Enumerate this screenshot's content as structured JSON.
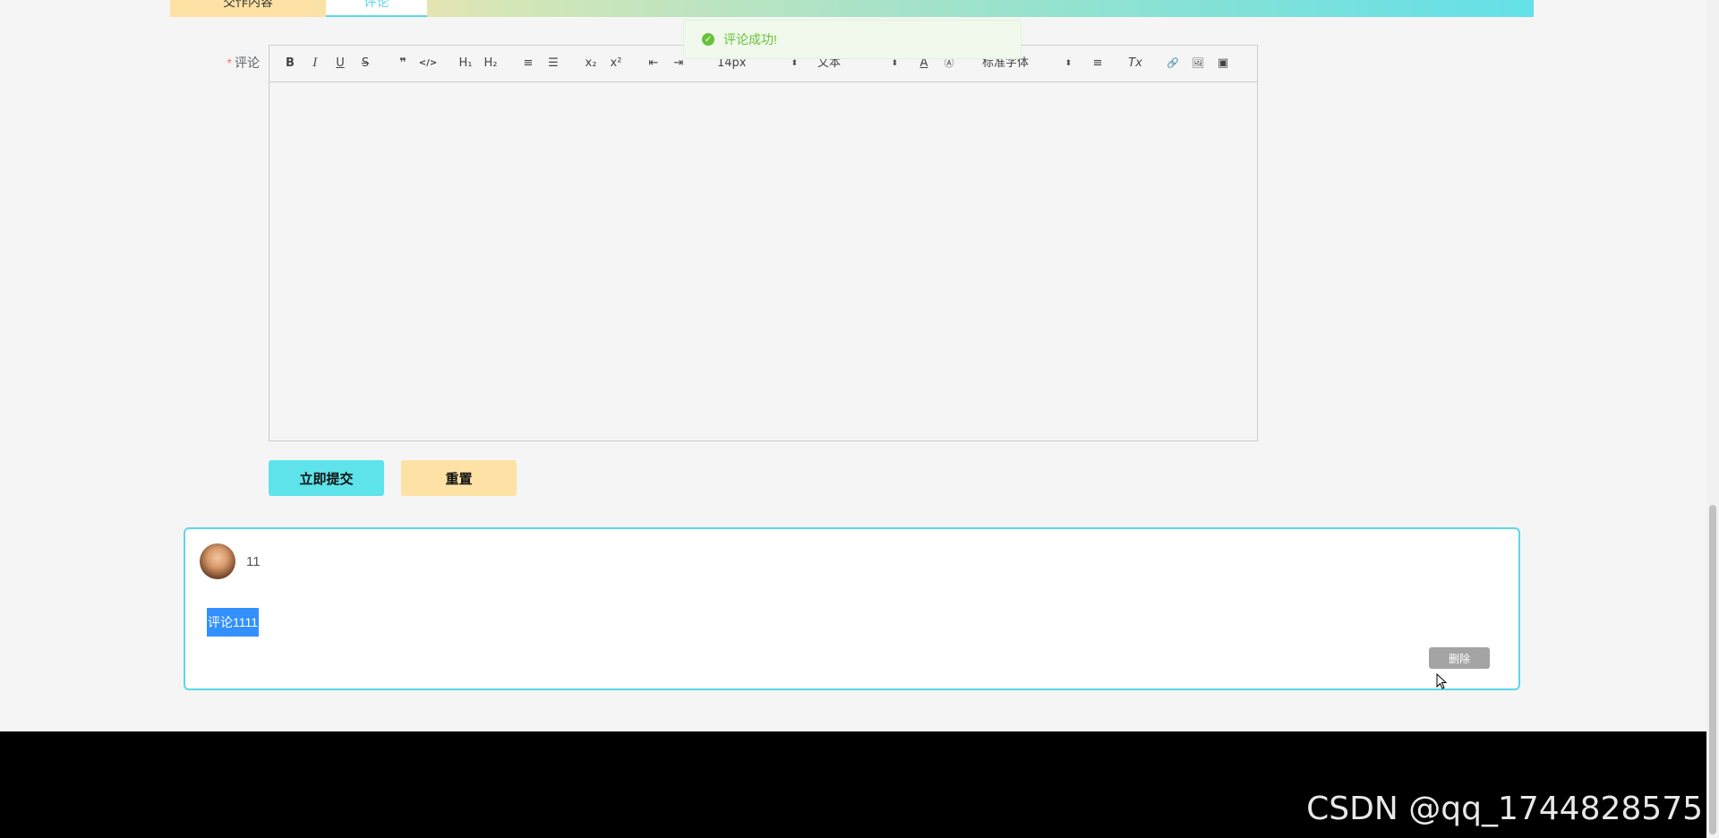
{
  "tabs": [
    {
      "label": "交作内容"
    },
    {
      "label": "评论"
    }
  ],
  "toast": {
    "text": "评论成功!"
  },
  "form": {
    "label": "评论",
    "required_mark": "*"
  },
  "toolbar": {
    "buttons": [
      "B",
      "I",
      "U",
      "S",
      "❞",
      "</>",
      "H₁",
      "H₂",
      "≡",
      "☰",
      "x₂",
      "x²",
      "⇤",
      "⇥"
    ],
    "font_size": "14px",
    "text_type": "文本",
    "font_family": "标准字体",
    "buttons2": [
      "≡",
      "Tx",
      "🔗",
      "🖼",
      "▣"
    ]
  },
  "buttons": {
    "submit": "立即提交",
    "reset": "重置"
  },
  "comment": {
    "user": "11",
    "content": "评论1111",
    "delete": "删除"
  },
  "watermark": "CSDN @qq_1744828575",
  "colors": {
    "accent": "#5ee3ea",
    "secondary": "#fde1a5",
    "success": "#67c23a"
  }
}
